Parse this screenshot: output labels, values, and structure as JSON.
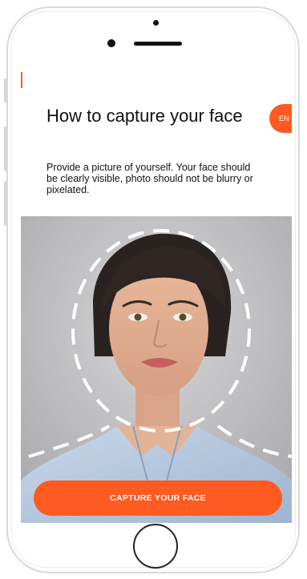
{
  "screen": {
    "title": "How to capture your face",
    "description": "Provide a picture of yourself. Your face should be clearly visible, photo should not be blurry or pixelated.",
    "language_badge": "EN",
    "capture_button_label": "CAPTURE YOUR FACE"
  },
  "colors": {
    "accent": "#ff5a1f",
    "text": "#111111",
    "photo_background": "#c9c9cb",
    "guide_stroke": "#ffffff"
  },
  "icons": {
    "face_guide": "dashed-oval-guide"
  }
}
